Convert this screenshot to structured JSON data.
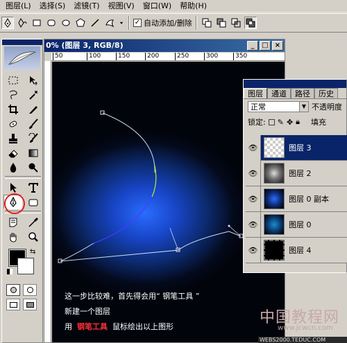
{
  "menu": {
    "items": [
      "图层(L)",
      "选择(S)",
      "滤镜(T)",
      "视图(V)",
      "窗口(W)",
      "帮助(H)"
    ]
  },
  "options": {
    "auto_add_delete_label": "自动添加/删除",
    "auto_add_delete_checked": true
  },
  "document": {
    "title": "0% (图层 3, RGB/8)",
    "ruler_ticks": [
      "50",
      "100",
      "150",
      "200",
      "250",
      "300",
      "350"
    ],
    "caption_line1": "这一步比较难，首先得会用“ 钢笔工具 ”",
    "caption_line2": "新建一个图层",
    "caption_line3_prefix": "用",
    "caption_line3_highlight": "钢笔工具",
    "caption_line3_suffix": "鼠标绘出以上图形"
  },
  "layers_panel": {
    "tabs": [
      "图层",
      "通道",
      "路径",
      "历史"
    ],
    "blend_mode": "正常",
    "opacity_label": "不透明度",
    "lock_label": "锁定:",
    "fill_label": "填充",
    "layers": [
      {
        "name": "图层 3",
        "selected": true
      },
      {
        "name": "图层 2",
        "selected": false
      },
      {
        "name": "图层 0 副本",
        "selected": false
      },
      {
        "name": "图层 0",
        "selected": false
      },
      {
        "name": "图层 4",
        "selected": false
      }
    ]
  },
  "watermark": {
    "site_name": "中国教程网",
    "url": "www.jcwcn.com"
  },
  "status_text": "WEBS2000.TEDUC.COM"
}
